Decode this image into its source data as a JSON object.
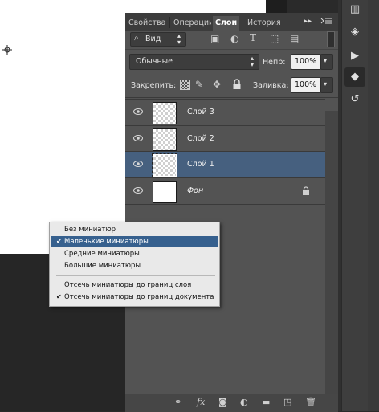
{
  "tabs": [
    {
      "label": "Свойства",
      "active": false
    },
    {
      "label": "Операции",
      "active": false
    },
    {
      "label": "Слои",
      "active": true
    },
    {
      "label": "История",
      "active": false
    }
  ],
  "filter": {
    "label": "Вид"
  },
  "blend_mode": {
    "value": "Обычные"
  },
  "opacity": {
    "label": "Непр:",
    "value": "100%"
  },
  "lock": {
    "label": "Закрепить:"
  },
  "fill": {
    "label": "Заливка:",
    "value": "100%"
  },
  "layers": [
    {
      "name": "Слой 3",
      "selected": false,
      "transparent": true
    },
    {
      "name": "Слой 2",
      "selected": false,
      "transparent": true
    },
    {
      "name": "Слой 1",
      "selected": true,
      "transparent": true
    },
    {
      "name": "Фон",
      "selected": false,
      "transparent": false,
      "locked": true
    }
  ],
  "context_menu": {
    "items": [
      {
        "label": "Без миниатюр",
        "checked": false,
        "highlighted": false
      },
      {
        "label": "Маленькие миниатюры",
        "checked": true,
        "highlighted": true
      },
      {
        "label": "Средние миниатюры",
        "checked": false,
        "highlighted": false
      },
      {
        "label": "Большие миниатюры",
        "checked": false,
        "highlighted": false
      },
      {
        "label": "Отсечь миниатюры до границ слоя",
        "checked": false,
        "highlighted": false
      },
      {
        "label": "Отсечь миниатюры до границ документа",
        "checked": true,
        "highlighted": false
      }
    ],
    "check_glyph": "✔"
  },
  "bottom_icons": [
    "link-icon",
    "fx-icon",
    "mask-icon",
    "adjustment-icon",
    "folder-icon",
    "new-layer-icon",
    "trash-icon"
  ],
  "bottom_fx_label": "fx",
  "colors": {
    "accent_selected": "#46607f",
    "menu_highlight": "#36608e",
    "panel_bg": "#535353"
  }
}
